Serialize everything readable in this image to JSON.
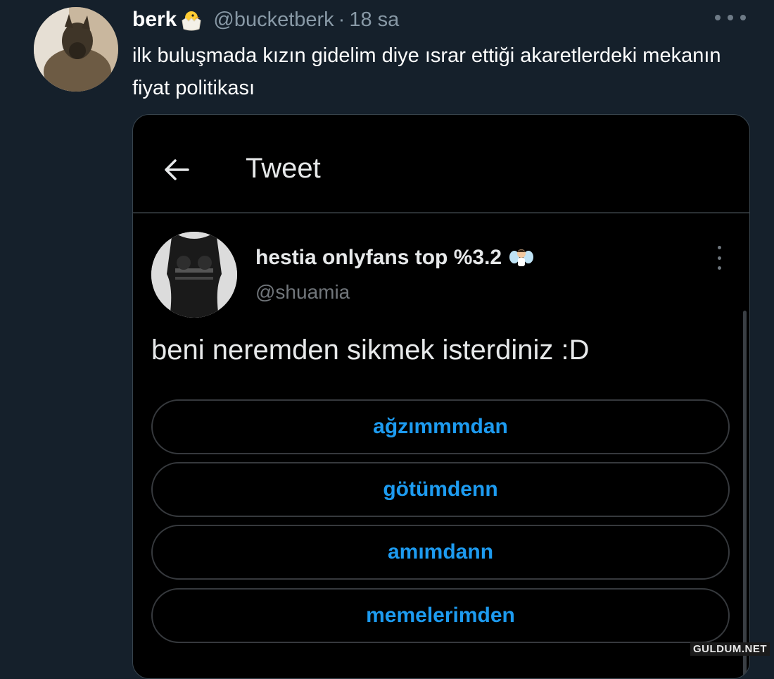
{
  "tweet": {
    "author_name": "berk",
    "author_badge": "hatching-chick-emoji",
    "handle": "@bucketberk",
    "separator": "·",
    "time": "18 sa",
    "text": "ilk buluşmada kızın gidelim diye ısrar ettiği akaretlerdeki mekanın fiyat politikası"
  },
  "screenshot": {
    "header_title": "Tweet",
    "author_name": "hestia onlyfans top %3.2",
    "author_badge": "fairy-emoji",
    "handle": "@shuamia",
    "text": "beni neremden sikmek isterdiniz :D",
    "poll_options": [
      "ağzımmmdan",
      "götümdenn",
      "amımdann",
      "memelerimden"
    ]
  },
  "colors": {
    "background": "#15202b",
    "accent": "#1d9bf0",
    "secondary_text": "#8899a6"
  },
  "watermark": "GULDUM.NET"
}
